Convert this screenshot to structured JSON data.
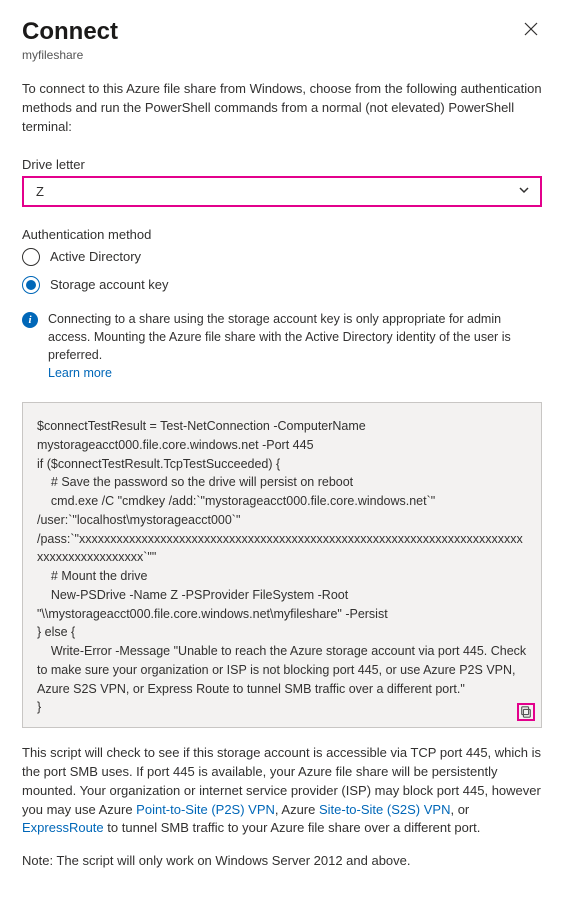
{
  "header": {
    "title": "Connect",
    "subtitle": "myfileshare"
  },
  "intro": "To connect to this Azure file share from Windows, choose from the following authentication methods and run the PowerShell commands from a normal (not elevated) PowerShell terminal:",
  "driveLetter": {
    "label": "Drive letter",
    "value": "Z"
  },
  "authMethod": {
    "label": "Authentication method",
    "options": {
      "ad": "Active Directory",
      "sak": "Storage account key"
    }
  },
  "info": {
    "text": "Connecting to a share using the storage account key is only appropriate for admin access. Mounting the Azure file share with the Active Directory identity of the user is preferred.",
    "link": "Learn more"
  },
  "script": "$connectTestResult = Test-NetConnection -ComputerName mystorageacct000.file.core.windows.net -Port 445\nif ($connectTestResult.TcpTestSucceeded) {\n    # Save the password so the drive will persist on reboot\n    cmd.exe /C \"cmdkey /add:`\"mystorageacct000.file.core.windows.net`\" /user:`\"localhost\\mystorageacct000`\" /pass:`\"xxxxxxxxxxxxxxxxxxxxxxxxxxxxxxxxxxxxxxxxxxxxxxxxxxxxxxxxxxxxxxxxxxxxxxxxxxxxxxxxxxxxxxxx`\"\"\n    # Mount the drive\n    New-PSDrive -Name Z -PSProvider FileSystem -Root \"\\\\mystorageacct000.file.core.windows.net\\myfileshare\" -Persist\n} else {\n    Write-Error -Message \"Unable to reach the Azure storage account via port 445. Check to make sure your organization or ISP is not blocking port 445, or use Azure P2S VPN, Azure S2S VPN, or Express Route to tunnel SMB traffic over a different port.\"\n}",
  "description": {
    "part1": "This script will check to see if this storage account is accessible via TCP port 445, which is the port SMB uses. If port 445 is available, your Azure file share will be persistently mounted. Your organization or internet service provider (ISP) may block port 445, however you may use Azure ",
    "link1": "Point-to-Site (P2S) VPN",
    "part2": ", Azure ",
    "link2": "Site-to-Site (S2S) VPN",
    "part3": ", or ",
    "link3": "ExpressRoute",
    "part4": " to tunnel SMB traffic to your Azure file share over a different port."
  },
  "note": "Note: The script will only work on Windows Server 2012 and above."
}
